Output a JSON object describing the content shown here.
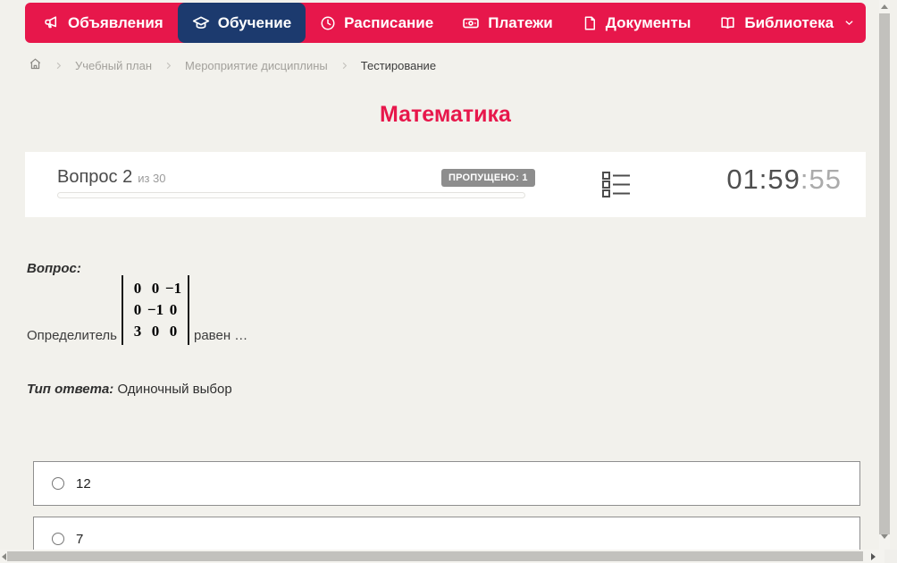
{
  "nav": {
    "items": [
      {
        "label": "Объявления",
        "icon": "megaphone-icon",
        "active": false
      },
      {
        "label": "Обучение",
        "icon": "graduation-cap-icon",
        "active": true
      },
      {
        "label": "Расписание",
        "icon": "clock-icon",
        "active": false
      },
      {
        "label": "Платежи",
        "icon": "banknote-icon",
        "active": false
      },
      {
        "label": "Документы",
        "icon": "document-icon",
        "active": false
      },
      {
        "label": "Библиотека",
        "icon": "book-icon",
        "active": false,
        "has_dropdown": true
      }
    ],
    "colors": {
      "bar": "#e7174b",
      "active_item": "#1c3a6e"
    }
  },
  "breadcrumb": {
    "items": [
      "Учебный план",
      "Мероприятие дисциплины",
      "Тестирование"
    ]
  },
  "page": {
    "title": "Математика",
    "title_color": "#e7174b",
    "background": "#f2f1ec"
  },
  "quiz": {
    "question_label": "Вопрос 2",
    "question_of": "из 30",
    "skipped_badge": "ПРОПУЩЕНО: 1",
    "timer": {
      "main": "01:59",
      "seconds": ":55"
    }
  },
  "question": {
    "prompt_label": "Вопрос:",
    "text_before_matrix": "Определитель",
    "matrix_rows": [
      [
        "0",
        "0",
        "−1"
      ],
      [
        "0",
        "−1",
        "0"
      ],
      [
        "3",
        "0",
        "0"
      ]
    ],
    "text_after_matrix": "равен …",
    "answer_type_label": "Тип ответа:",
    "answer_type_value": "Одиночный выбор"
  },
  "options": [
    {
      "label": "12",
      "selected": false
    },
    {
      "label": "7",
      "selected": false
    }
  ]
}
